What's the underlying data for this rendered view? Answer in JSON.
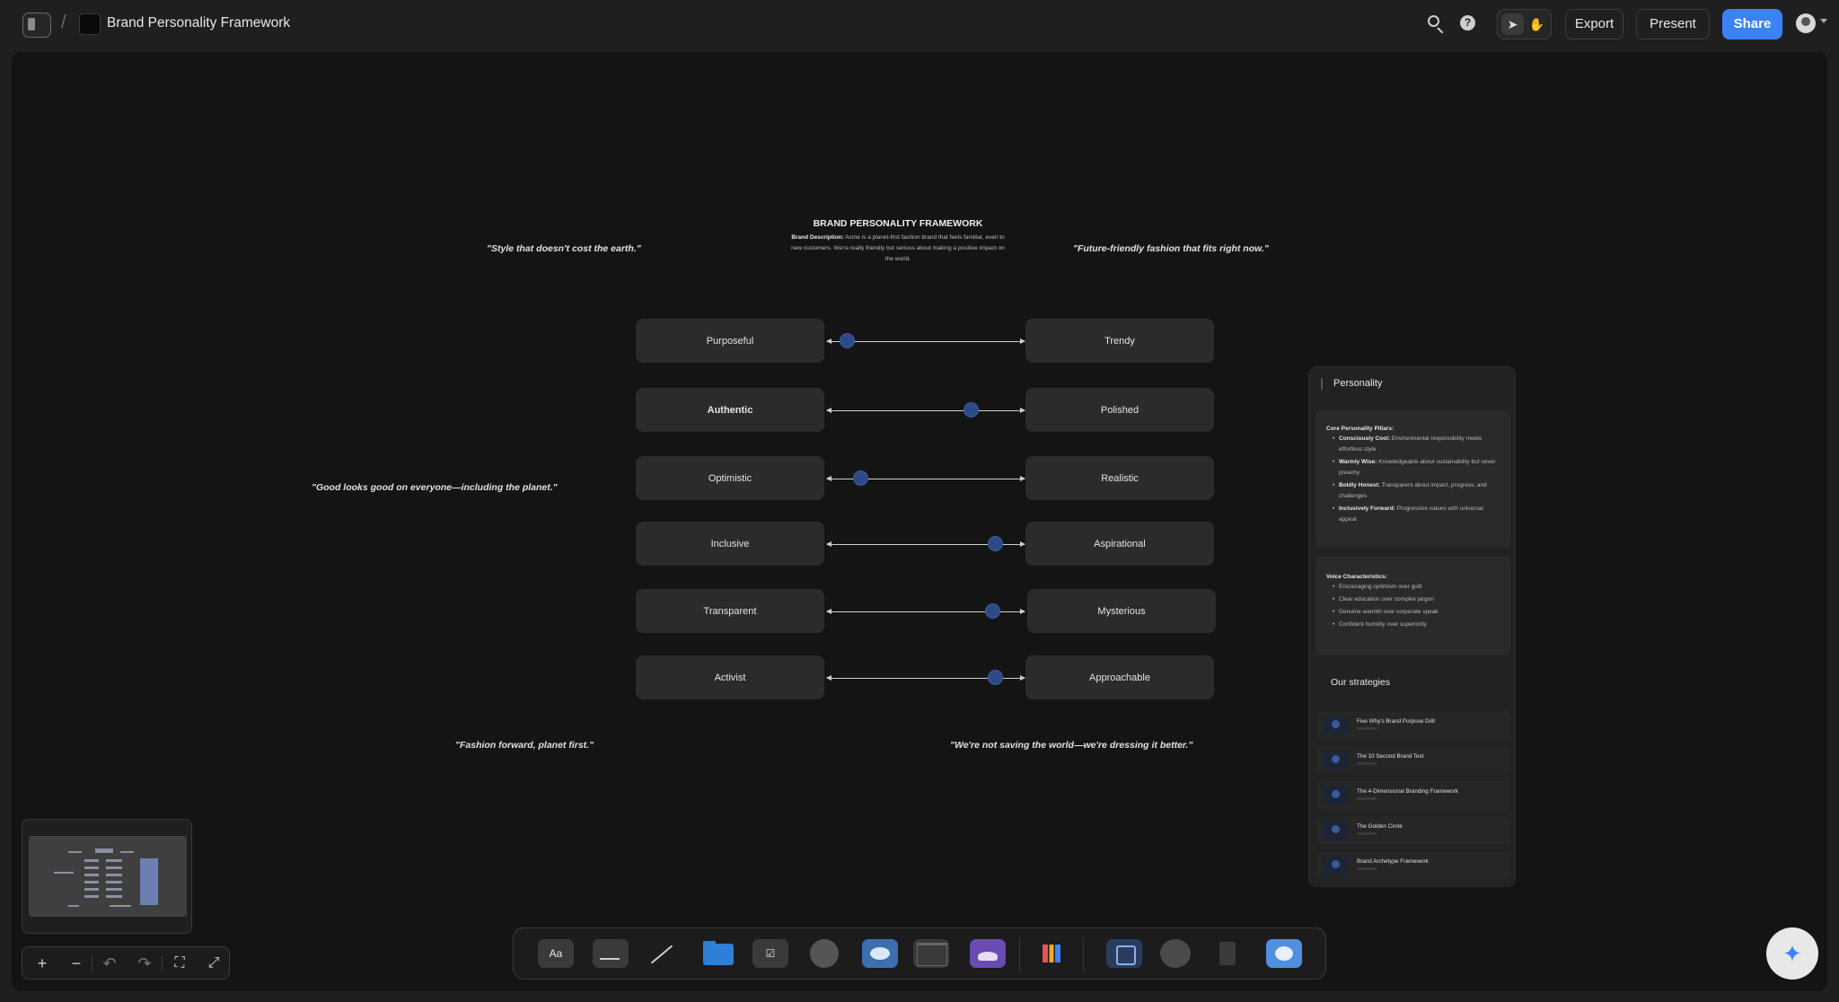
{
  "header": {
    "board_title": "Brand Personality Framework",
    "breadcrumb_sep": "/",
    "export_label": "Export",
    "present_label": "Present",
    "share_label": "Share",
    "help_glyph": "?"
  },
  "framework": {
    "title": "BRAND PERSONALITY FRAMEWORK",
    "description_label": "Brand Description:",
    "description": "Acme is a planet-first fashion brand that feels familiar, even to new customers. We're really friendly but serious about making a positive impact on the world."
  },
  "quotes": {
    "q1": "\"Style that doesn't cost the earth.\"",
    "q2": "\"Future-friendly fashion that fits right now.\"",
    "q3": "\"Good looks good on everyone—including the planet.\"",
    "q4": "\"Fashion forward, planet first.\"",
    "q5": "\"We're not saving the world—we're dressing it better.\""
  },
  "sliders": [
    {
      "left": "Purposeful",
      "right": "Trendy",
      "value": 0.1
    },
    {
      "left": "Authentic",
      "right": "Polished",
      "value": 0.73
    },
    {
      "left": "Optimistic",
      "right": "Realistic",
      "value": 0.17
    },
    {
      "left": "Inclusive",
      "right": "Aspirational",
      "value": 0.85
    },
    {
      "left": "Transparent",
      "right": "Mysterious",
      "value": 0.84
    },
    {
      "left": "Activist",
      "right": "Approachable",
      "value": 0.85
    }
  ],
  "panel": {
    "title": "Personality",
    "pillars_heading": "Core Personality Pillars:",
    "pillars": [
      {
        "name": "Consciously Cool:",
        "text": "Environmental responsibility meets effortless style"
      },
      {
        "name": "Warmly Wise:",
        "text": "Knowledgeable about sustainability but never preachy"
      },
      {
        "name": "Boldly Honest:",
        "text": "Transparent about impact, progress, and challenges"
      },
      {
        "name": "Inclusively Forward:",
        "text": "Progressive values with universal appeal"
      }
    ],
    "voice_heading": "Voice Characteristics:",
    "voice": [
      "Encouraging optimism over guilt",
      "Clear education over complex jargon",
      "Genuine warmth over corporate speak",
      "Confident humility over superiority"
    ],
    "strategies_title": "Our strategies",
    "strategies": [
      "Five Why's Brand Purpose Drill",
      "The 10 Second Brand Test",
      "The 4-Dimensional Branding Framework",
      "The Golden Circle",
      "Brand Archetype Framework"
    ]
  },
  "dock": {
    "text_tool_label": "Aa",
    "todo_tool_glyph": "☑"
  },
  "zoom": {
    "zoom_in": "+",
    "zoom_out": "−",
    "undo": "↶",
    "redo": "↷",
    "fit": "⛶",
    "fullscreen": "⤢"
  },
  "assistant_glyph": "✦"
}
